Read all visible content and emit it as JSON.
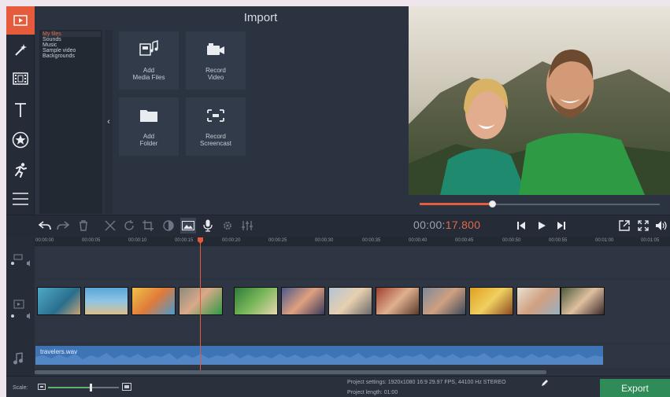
{
  "import": {
    "title": "Import",
    "file_list": [
      "My files",
      "Sounds",
      "Music",
      "Sample video",
      "Backgrounds"
    ],
    "collapse_icon": "‹",
    "tiles": [
      {
        "line1": "Add",
        "line2": "Media Files",
        "icon": "media-files-icon"
      },
      {
        "line1": "Record",
        "line2": "Video",
        "icon": "camera-icon"
      },
      {
        "line1": "Add",
        "line2": "Folder",
        "icon": "folder-icon"
      },
      {
        "line1": "Record",
        "line2": "Screencast",
        "icon": "screencast-icon"
      }
    ]
  },
  "rail_tools": [
    "import-icon",
    "magic-wand-icon",
    "filmstrip-icon",
    "text-icon",
    "star-icon",
    "runner-icon",
    "list-icon"
  ],
  "player": {
    "time_prefix": "00:00:",
    "time_highlight": "17.800",
    "progress": 0.3
  },
  "timeline": {
    "ruler": [
      "00:00:00",
      "00:00:05",
      "00:00:10",
      "00:00:15",
      "00:00:20",
      "00:00:25",
      "00:00:30",
      "00:00:35",
      "00:00:40",
      "00:00:45",
      "00:00:50",
      "00:00:55",
      "00:01:00",
      "00:01:05"
    ],
    "audio_label": "travelers.wav"
  },
  "bottom": {
    "scale_label": "Scale:",
    "project_settings": "Project settings:  1920x1080 16:9 29.97 FPS, 44100 Hz STEREO",
    "project_length": "Project length:   01:00",
    "export_label": "Export"
  },
  "colors": {
    "accent": "#e55b3c",
    "export": "#2f8b58",
    "audio": "#3d74b6",
    "background": "#2b3340"
  }
}
